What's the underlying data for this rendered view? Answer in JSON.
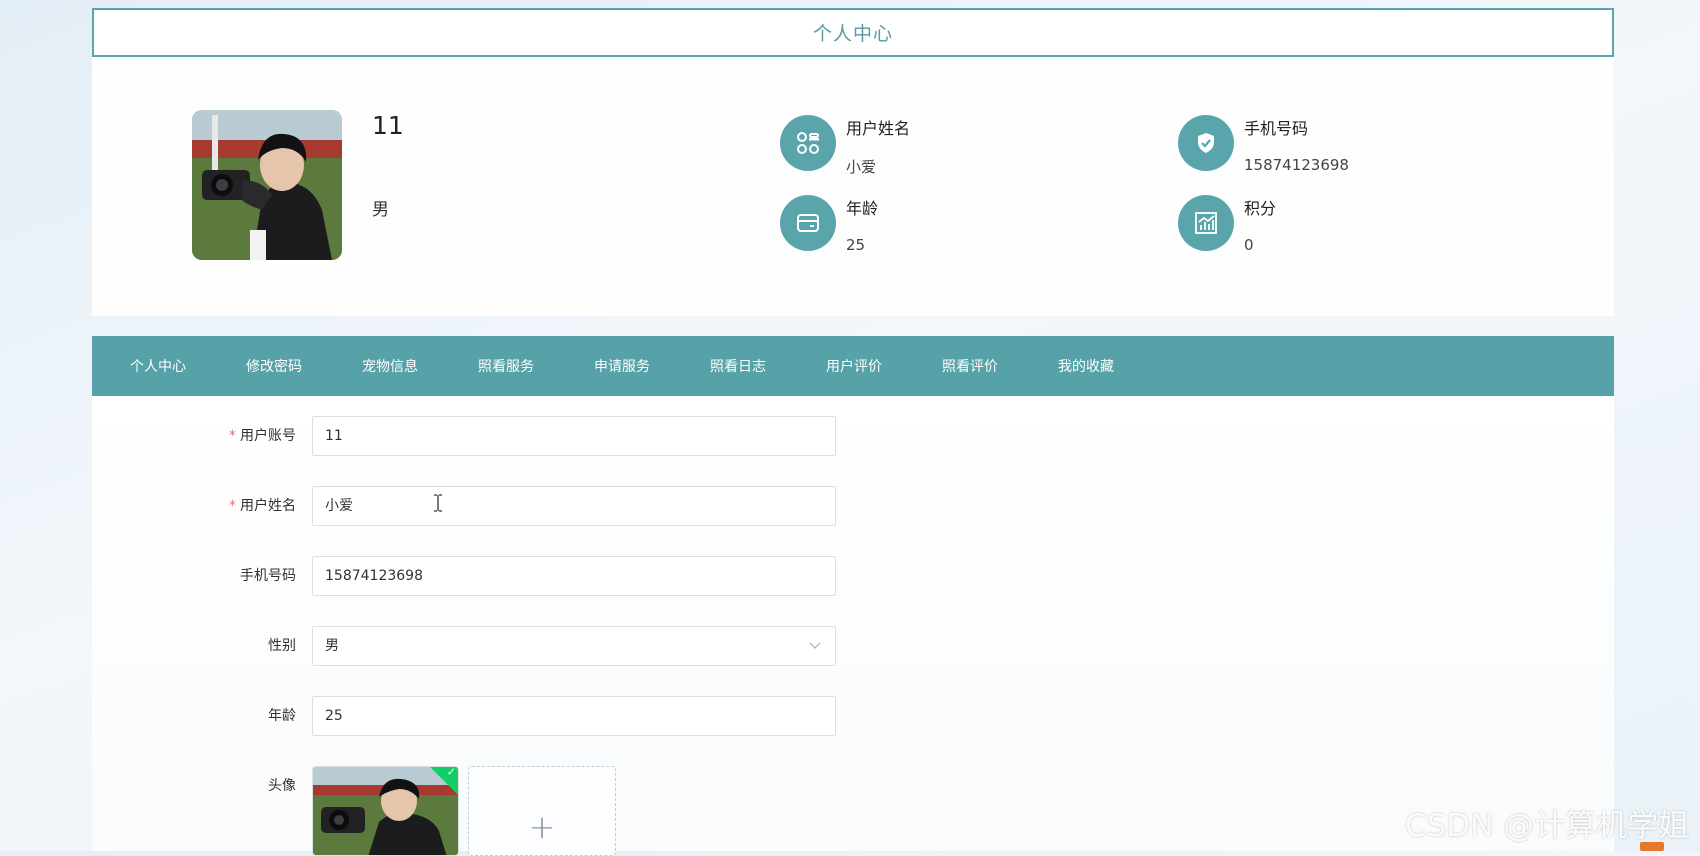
{
  "page_title": "个人中心",
  "profile": {
    "account": "11",
    "gender": "男",
    "fields": [
      {
        "label": "用户姓名",
        "value": "小爱",
        "icon": "apps-icon"
      },
      {
        "label": "手机号码",
        "value": "15874123698",
        "icon": "shield-check-icon"
      },
      {
        "label": "年龄",
        "value": "25",
        "icon": "card-icon"
      },
      {
        "label": "积分",
        "value": "0",
        "icon": "chart-icon"
      }
    ]
  },
  "tabs": [
    "个人中心",
    "修改密码",
    "宠物信息",
    "照看服务",
    "申请服务",
    "照看日志",
    "用户评价",
    "照看评价",
    "我的收藏"
  ],
  "form": {
    "account": {
      "label": "用户账号",
      "value": "11",
      "required": true
    },
    "name": {
      "label": "用户姓名",
      "value": "小爱",
      "required": true
    },
    "phone": {
      "label": "手机号码",
      "value": "15874123698",
      "required": false
    },
    "gender": {
      "label": "性别",
      "value": "男",
      "required": false
    },
    "age": {
      "label": "年龄",
      "value": "25",
      "required": false
    },
    "avatar": {
      "label": "头像",
      "add_symbol": "+"
    }
  },
  "watermark": "CSDN @计算机学姐",
  "colors": {
    "accent": "#56a2a8",
    "required": "#f56c6c",
    "success": "#13ce66"
  }
}
